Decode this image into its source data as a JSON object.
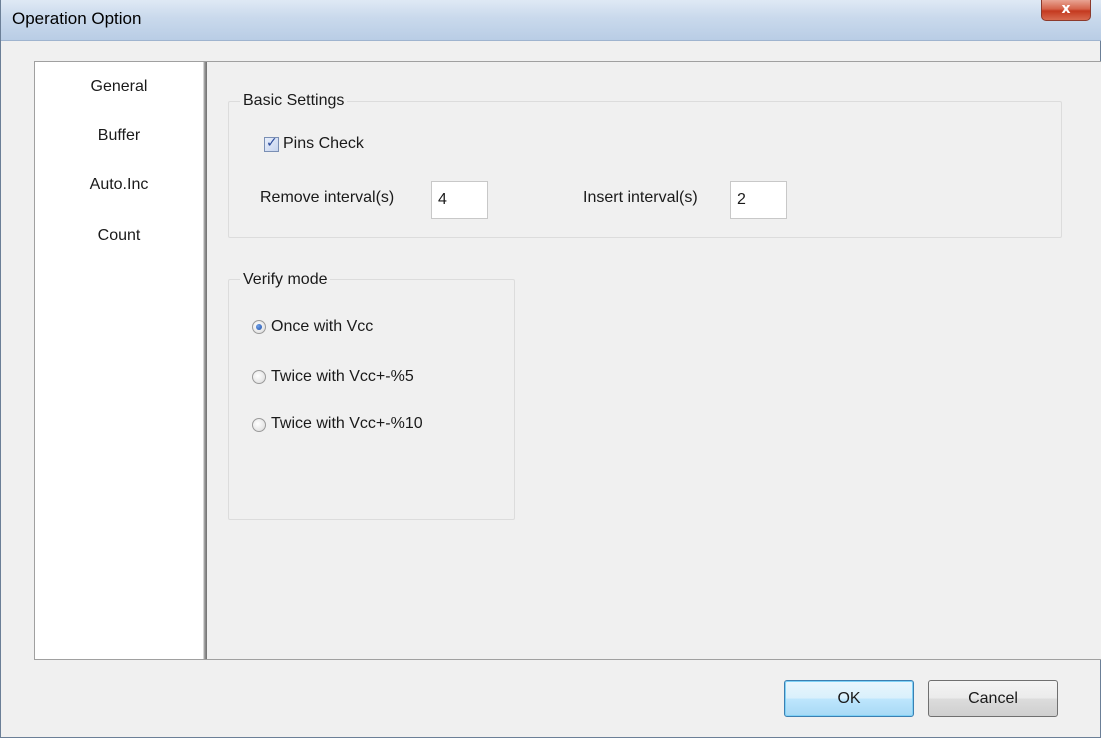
{
  "window": {
    "title": "Operation Option",
    "close_label": "x"
  },
  "nav": {
    "items": [
      {
        "label": "General"
      },
      {
        "label": "Buffer"
      },
      {
        "label": "Auto.Inc"
      },
      {
        "label": "Count"
      }
    ]
  },
  "basic_settings": {
    "title": "Basic Settings",
    "pins_check": {
      "label": "Pins Check",
      "checked": true
    },
    "remove_interval": {
      "label": "Remove interval(s)",
      "value": "4"
    },
    "insert_interval": {
      "label": "Insert interval(s)",
      "value": "2"
    }
  },
  "verify_mode": {
    "title": "Verify mode",
    "options": [
      {
        "label": "Once with Vcc",
        "selected": true
      },
      {
        "label": "Twice with Vcc+-%5",
        "selected": false
      },
      {
        "label": "Twice with Vcc+-%10",
        "selected": false
      }
    ]
  },
  "buttons": {
    "ok": "OK",
    "cancel": "Cancel"
  }
}
